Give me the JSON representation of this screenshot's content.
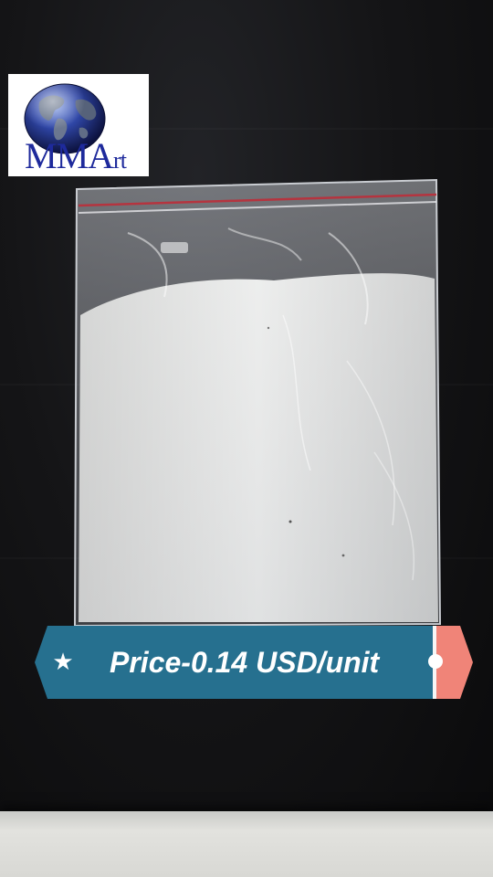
{
  "logo": {
    "text_caps": "MMA",
    "text_small": "rt",
    "icon": "globe-icon"
  },
  "banner": {
    "label": "Price-0.14 USD/unit",
    "icon": "star-icon",
    "colors": {
      "background": "#26708f",
      "accent": "#f08478",
      "text": "#ffffff"
    }
  },
  "product": {
    "description_icon": "plastic-bag-with-white-powder"
  }
}
